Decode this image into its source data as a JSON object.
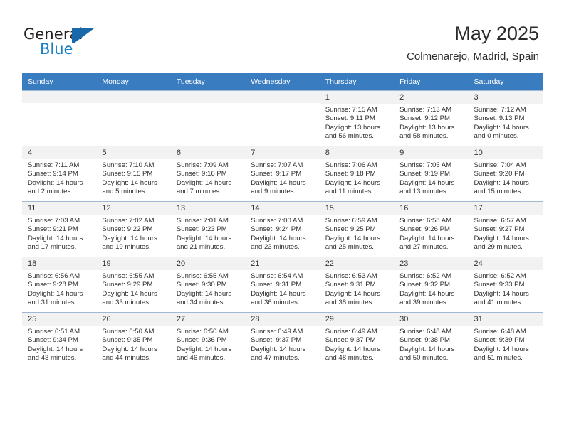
{
  "brand": {
    "name_top": "General",
    "name_bottom": "Blue",
    "accent_color": "#1769aa",
    "text_color": "#231f20"
  },
  "header": {
    "month_title": "May 2025",
    "location": "Colmenarejo, Madrid, Spain"
  },
  "theme": {
    "header_row_bg": "#3a7cc0",
    "header_row_text": "#ffffff",
    "daynum_band_bg": "#f2f2f2",
    "cell_border": "#9fb8d4",
    "body_bg": "#ffffff"
  },
  "weekday_headers": [
    "Sunday",
    "Monday",
    "Tuesday",
    "Wednesday",
    "Thursday",
    "Friday",
    "Saturday"
  ],
  "weeks": [
    [
      {
        "empty": true
      },
      {
        "empty": true
      },
      {
        "empty": true
      },
      {
        "empty": true
      },
      {
        "day": "1",
        "sunrise": "Sunrise: 7:15 AM",
        "sunset": "Sunset: 9:11 PM",
        "daylight1": "Daylight: 13 hours",
        "daylight2": "and 56 minutes."
      },
      {
        "day": "2",
        "sunrise": "Sunrise: 7:13 AM",
        "sunset": "Sunset: 9:12 PM",
        "daylight1": "Daylight: 13 hours",
        "daylight2": "and 58 minutes."
      },
      {
        "day": "3",
        "sunrise": "Sunrise: 7:12 AM",
        "sunset": "Sunset: 9:13 PM",
        "daylight1": "Daylight: 14 hours",
        "daylight2": "and 0 minutes."
      }
    ],
    [
      {
        "day": "4",
        "sunrise": "Sunrise: 7:11 AM",
        "sunset": "Sunset: 9:14 PM",
        "daylight1": "Daylight: 14 hours",
        "daylight2": "and 2 minutes."
      },
      {
        "day": "5",
        "sunrise": "Sunrise: 7:10 AM",
        "sunset": "Sunset: 9:15 PM",
        "daylight1": "Daylight: 14 hours",
        "daylight2": "and 5 minutes."
      },
      {
        "day": "6",
        "sunrise": "Sunrise: 7:09 AM",
        "sunset": "Sunset: 9:16 PM",
        "daylight1": "Daylight: 14 hours",
        "daylight2": "and 7 minutes."
      },
      {
        "day": "7",
        "sunrise": "Sunrise: 7:07 AM",
        "sunset": "Sunset: 9:17 PM",
        "daylight1": "Daylight: 14 hours",
        "daylight2": "and 9 minutes."
      },
      {
        "day": "8",
        "sunrise": "Sunrise: 7:06 AM",
        "sunset": "Sunset: 9:18 PM",
        "daylight1": "Daylight: 14 hours",
        "daylight2": "and 11 minutes."
      },
      {
        "day": "9",
        "sunrise": "Sunrise: 7:05 AM",
        "sunset": "Sunset: 9:19 PM",
        "daylight1": "Daylight: 14 hours",
        "daylight2": "and 13 minutes."
      },
      {
        "day": "10",
        "sunrise": "Sunrise: 7:04 AM",
        "sunset": "Sunset: 9:20 PM",
        "daylight1": "Daylight: 14 hours",
        "daylight2": "and 15 minutes."
      }
    ],
    [
      {
        "day": "11",
        "sunrise": "Sunrise: 7:03 AM",
        "sunset": "Sunset: 9:21 PM",
        "daylight1": "Daylight: 14 hours",
        "daylight2": "and 17 minutes."
      },
      {
        "day": "12",
        "sunrise": "Sunrise: 7:02 AM",
        "sunset": "Sunset: 9:22 PM",
        "daylight1": "Daylight: 14 hours",
        "daylight2": "and 19 minutes."
      },
      {
        "day": "13",
        "sunrise": "Sunrise: 7:01 AM",
        "sunset": "Sunset: 9:23 PM",
        "daylight1": "Daylight: 14 hours",
        "daylight2": "and 21 minutes."
      },
      {
        "day": "14",
        "sunrise": "Sunrise: 7:00 AM",
        "sunset": "Sunset: 9:24 PM",
        "daylight1": "Daylight: 14 hours",
        "daylight2": "and 23 minutes."
      },
      {
        "day": "15",
        "sunrise": "Sunrise: 6:59 AM",
        "sunset": "Sunset: 9:25 PM",
        "daylight1": "Daylight: 14 hours",
        "daylight2": "and 25 minutes."
      },
      {
        "day": "16",
        "sunrise": "Sunrise: 6:58 AM",
        "sunset": "Sunset: 9:26 PM",
        "daylight1": "Daylight: 14 hours",
        "daylight2": "and 27 minutes."
      },
      {
        "day": "17",
        "sunrise": "Sunrise: 6:57 AM",
        "sunset": "Sunset: 9:27 PM",
        "daylight1": "Daylight: 14 hours",
        "daylight2": "and 29 minutes."
      }
    ],
    [
      {
        "day": "18",
        "sunrise": "Sunrise: 6:56 AM",
        "sunset": "Sunset: 9:28 PM",
        "daylight1": "Daylight: 14 hours",
        "daylight2": "and 31 minutes."
      },
      {
        "day": "19",
        "sunrise": "Sunrise: 6:55 AM",
        "sunset": "Sunset: 9:29 PM",
        "daylight1": "Daylight: 14 hours",
        "daylight2": "and 33 minutes."
      },
      {
        "day": "20",
        "sunrise": "Sunrise: 6:55 AM",
        "sunset": "Sunset: 9:30 PM",
        "daylight1": "Daylight: 14 hours",
        "daylight2": "and 34 minutes."
      },
      {
        "day": "21",
        "sunrise": "Sunrise: 6:54 AM",
        "sunset": "Sunset: 9:31 PM",
        "daylight1": "Daylight: 14 hours",
        "daylight2": "and 36 minutes."
      },
      {
        "day": "22",
        "sunrise": "Sunrise: 6:53 AM",
        "sunset": "Sunset: 9:31 PM",
        "daylight1": "Daylight: 14 hours",
        "daylight2": "and 38 minutes."
      },
      {
        "day": "23",
        "sunrise": "Sunrise: 6:52 AM",
        "sunset": "Sunset: 9:32 PM",
        "daylight1": "Daylight: 14 hours",
        "daylight2": "and 39 minutes."
      },
      {
        "day": "24",
        "sunrise": "Sunrise: 6:52 AM",
        "sunset": "Sunset: 9:33 PM",
        "daylight1": "Daylight: 14 hours",
        "daylight2": "and 41 minutes."
      }
    ],
    [
      {
        "day": "25",
        "sunrise": "Sunrise: 6:51 AM",
        "sunset": "Sunset: 9:34 PM",
        "daylight1": "Daylight: 14 hours",
        "daylight2": "and 43 minutes."
      },
      {
        "day": "26",
        "sunrise": "Sunrise: 6:50 AM",
        "sunset": "Sunset: 9:35 PM",
        "daylight1": "Daylight: 14 hours",
        "daylight2": "and 44 minutes."
      },
      {
        "day": "27",
        "sunrise": "Sunrise: 6:50 AM",
        "sunset": "Sunset: 9:36 PM",
        "daylight1": "Daylight: 14 hours",
        "daylight2": "and 46 minutes."
      },
      {
        "day": "28",
        "sunrise": "Sunrise: 6:49 AM",
        "sunset": "Sunset: 9:37 PM",
        "daylight1": "Daylight: 14 hours",
        "daylight2": "and 47 minutes."
      },
      {
        "day": "29",
        "sunrise": "Sunrise: 6:49 AM",
        "sunset": "Sunset: 9:37 PM",
        "daylight1": "Daylight: 14 hours",
        "daylight2": "and 48 minutes."
      },
      {
        "day": "30",
        "sunrise": "Sunrise: 6:48 AM",
        "sunset": "Sunset: 9:38 PM",
        "daylight1": "Daylight: 14 hours",
        "daylight2": "and 50 minutes."
      },
      {
        "day": "31",
        "sunrise": "Sunrise: 6:48 AM",
        "sunset": "Sunset: 9:39 PM",
        "daylight1": "Daylight: 14 hours",
        "daylight2": "and 51 minutes."
      }
    ]
  ]
}
